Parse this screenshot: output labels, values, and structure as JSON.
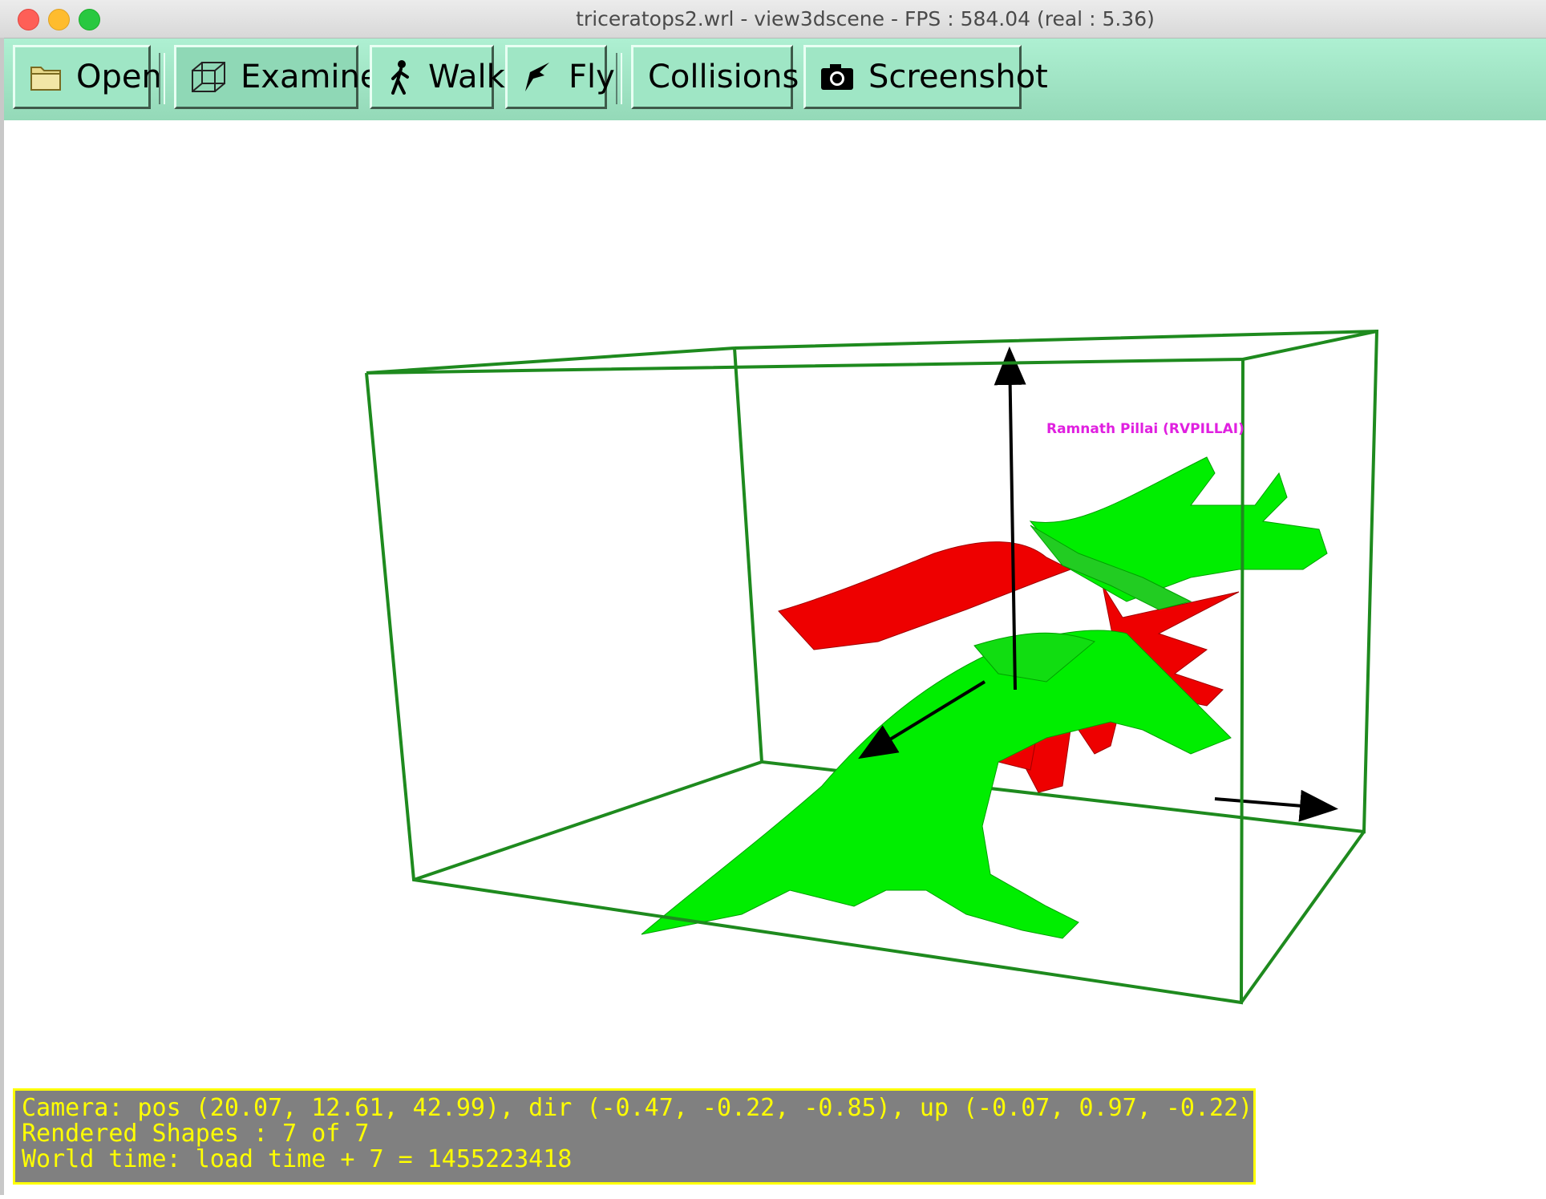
{
  "window": {
    "title": "triceratops2.wrl - view3dscene - FPS : 584.04 (real : 5.36)"
  },
  "toolbar": {
    "buttons": [
      {
        "label": "Open",
        "icon": "folder-icon"
      },
      {
        "label": "Examine",
        "icon": "cube-icon"
      },
      {
        "label": "Walk",
        "icon": "walk-icon"
      },
      {
        "label": "Fly",
        "icon": "fly-icon"
      },
      {
        "label": "Collisions",
        "icon": ""
      },
      {
        "label": "Screenshot",
        "icon": "camera-icon"
      }
    ]
  },
  "scene": {
    "model_label": "Ramnath Pillai (RVPILLAI)",
    "colors": {
      "bbox": "#1e8a1e",
      "model_green": "#00ee00",
      "model_red": "#ee0000",
      "axes": "#000000",
      "label": "#e020e0"
    }
  },
  "status": {
    "camera": "Camera: pos (20.07, 12.61, 42.99), dir (-0.47, -0.22, -0.85), up (-0.07, 0.97, -0.22)",
    "rendered_shapes": "Rendered Shapes : 7 of 7",
    "world_time": "World time: load time + 7 = 1455223418"
  }
}
